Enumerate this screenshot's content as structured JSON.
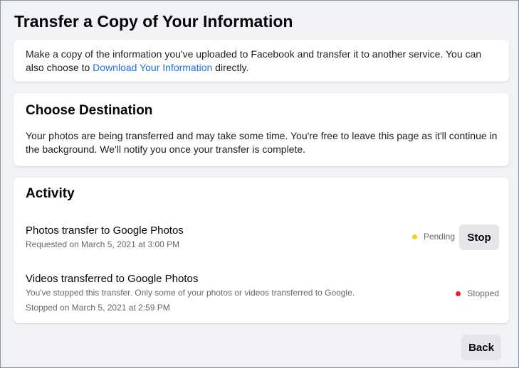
{
  "page": {
    "title": "Transfer a Copy of Your Information"
  },
  "intro": {
    "text_before_link": "Make a copy of the information you've uploaded to Facebook and transfer it to another service. You can also choose to ",
    "link_text": "Download Your Information",
    "text_after_link": " directly."
  },
  "destination": {
    "heading": "Choose Destination",
    "text": "Your photos are being transferred and may take some time. You're free to leave this page as it'll continue in the background. We'll notify you once your transfer is complete."
  },
  "activity": {
    "heading": "Activity",
    "items": [
      {
        "title": "Photos transfer to Google Photos",
        "subtitle": "Requested on March 5, 2021 at 3:00 PM",
        "status": "Pending",
        "status_color": "#f7d21b",
        "action_label": "Stop"
      },
      {
        "title": "Videos transferred to Google Photos",
        "subtitle": "You've stopped this transfer. Only some of your photos or videos transferred to Google.",
        "detail": "Stopped on March 5, 2021 at 2:59 PM",
        "status": "Stopped",
        "status_color": "#e4222e"
      }
    ]
  },
  "footer": {
    "back_label": "Back"
  },
  "colors": {
    "background": "#f0f2f5",
    "link": "#216fdb",
    "button_bg": "#e4e6eb"
  }
}
